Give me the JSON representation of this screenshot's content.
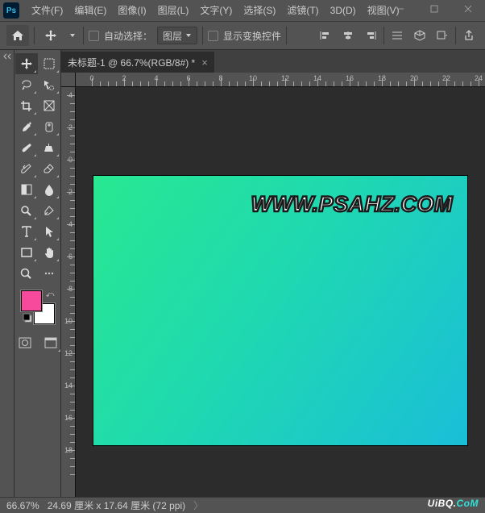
{
  "app": {
    "logo": "Ps"
  },
  "menus": [
    "文件(F)",
    "编辑(E)",
    "图像(I)",
    "图层(L)",
    "文字(Y)",
    "选择(S)",
    "滤镜(T)",
    "3D(D)",
    "视图(V)"
  ],
  "optbar": {
    "auto_select": "自动选择：",
    "layer_dd": "图层",
    "show_transform": "显示变换控件"
  },
  "tab": {
    "title": "未标题-1 @ 66.7%(RGB/8#) *"
  },
  "ruler_h": [
    0,
    2,
    4,
    6,
    8,
    10,
    12,
    14,
    16,
    18,
    20,
    22,
    24
  ],
  "ruler_v": [
    4,
    2,
    0,
    2,
    4,
    6,
    8,
    10,
    12,
    14,
    16,
    18
  ],
  "canvas": {
    "watermark": "WWW.PSAHZ.COM"
  },
  "status": {
    "zoom": "66.67%",
    "dim": "24.69 厘米 x 17.64 厘米 (72 ppi)"
  },
  "brand": {
    "a": "UiBQ.",
    "b": "CoM"
  },
  "colors": {
    "fg": "#f84a9d",
    "bg": "#ffffff"
  }
}
